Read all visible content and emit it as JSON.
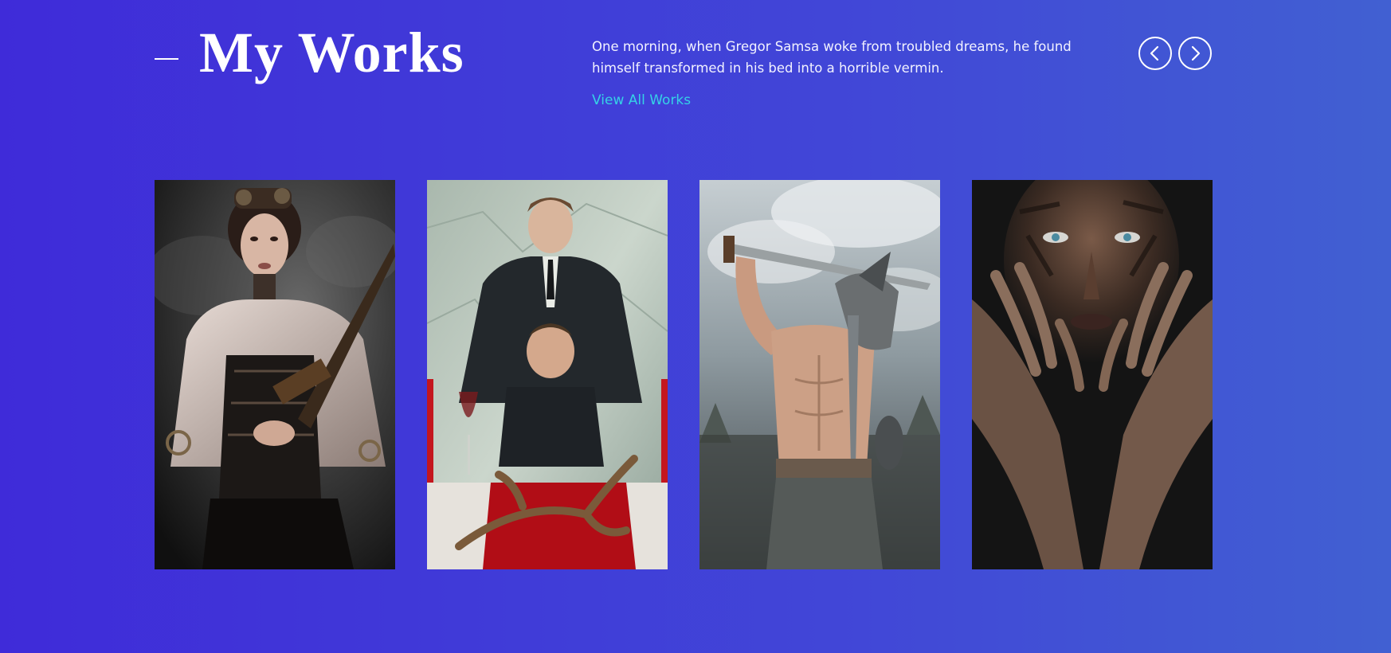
{
  "header": {
    "title": "My Works",
    "description": "One morning, when Gregor Samsa woke from troubled dreams, he found himself transformed in his bed into a horrible vermin.",
    "view_all_label": "View All Works"
  },
  "navigation": {
    "prev_icon": "chevron-left-icon",
    "next_icon": "chevron-right-icon"
  },
  "colors": {
    "background_start": "#3f2bd9",
    "background_end": "#4160d2",
    "link": "#35d2e6",
    "text": "#ffffff"
  },
  "works": [
    {
      "icon": "steampunk-woman-portrait"
    },
    {
      "icon": "two-men-in-suits-portrait"
    },
    {
      "icon": "gladiator-warrior-portrait"
    },
    {
      "icon": "painted-face-hands-portrait"
    }
  ]
}
